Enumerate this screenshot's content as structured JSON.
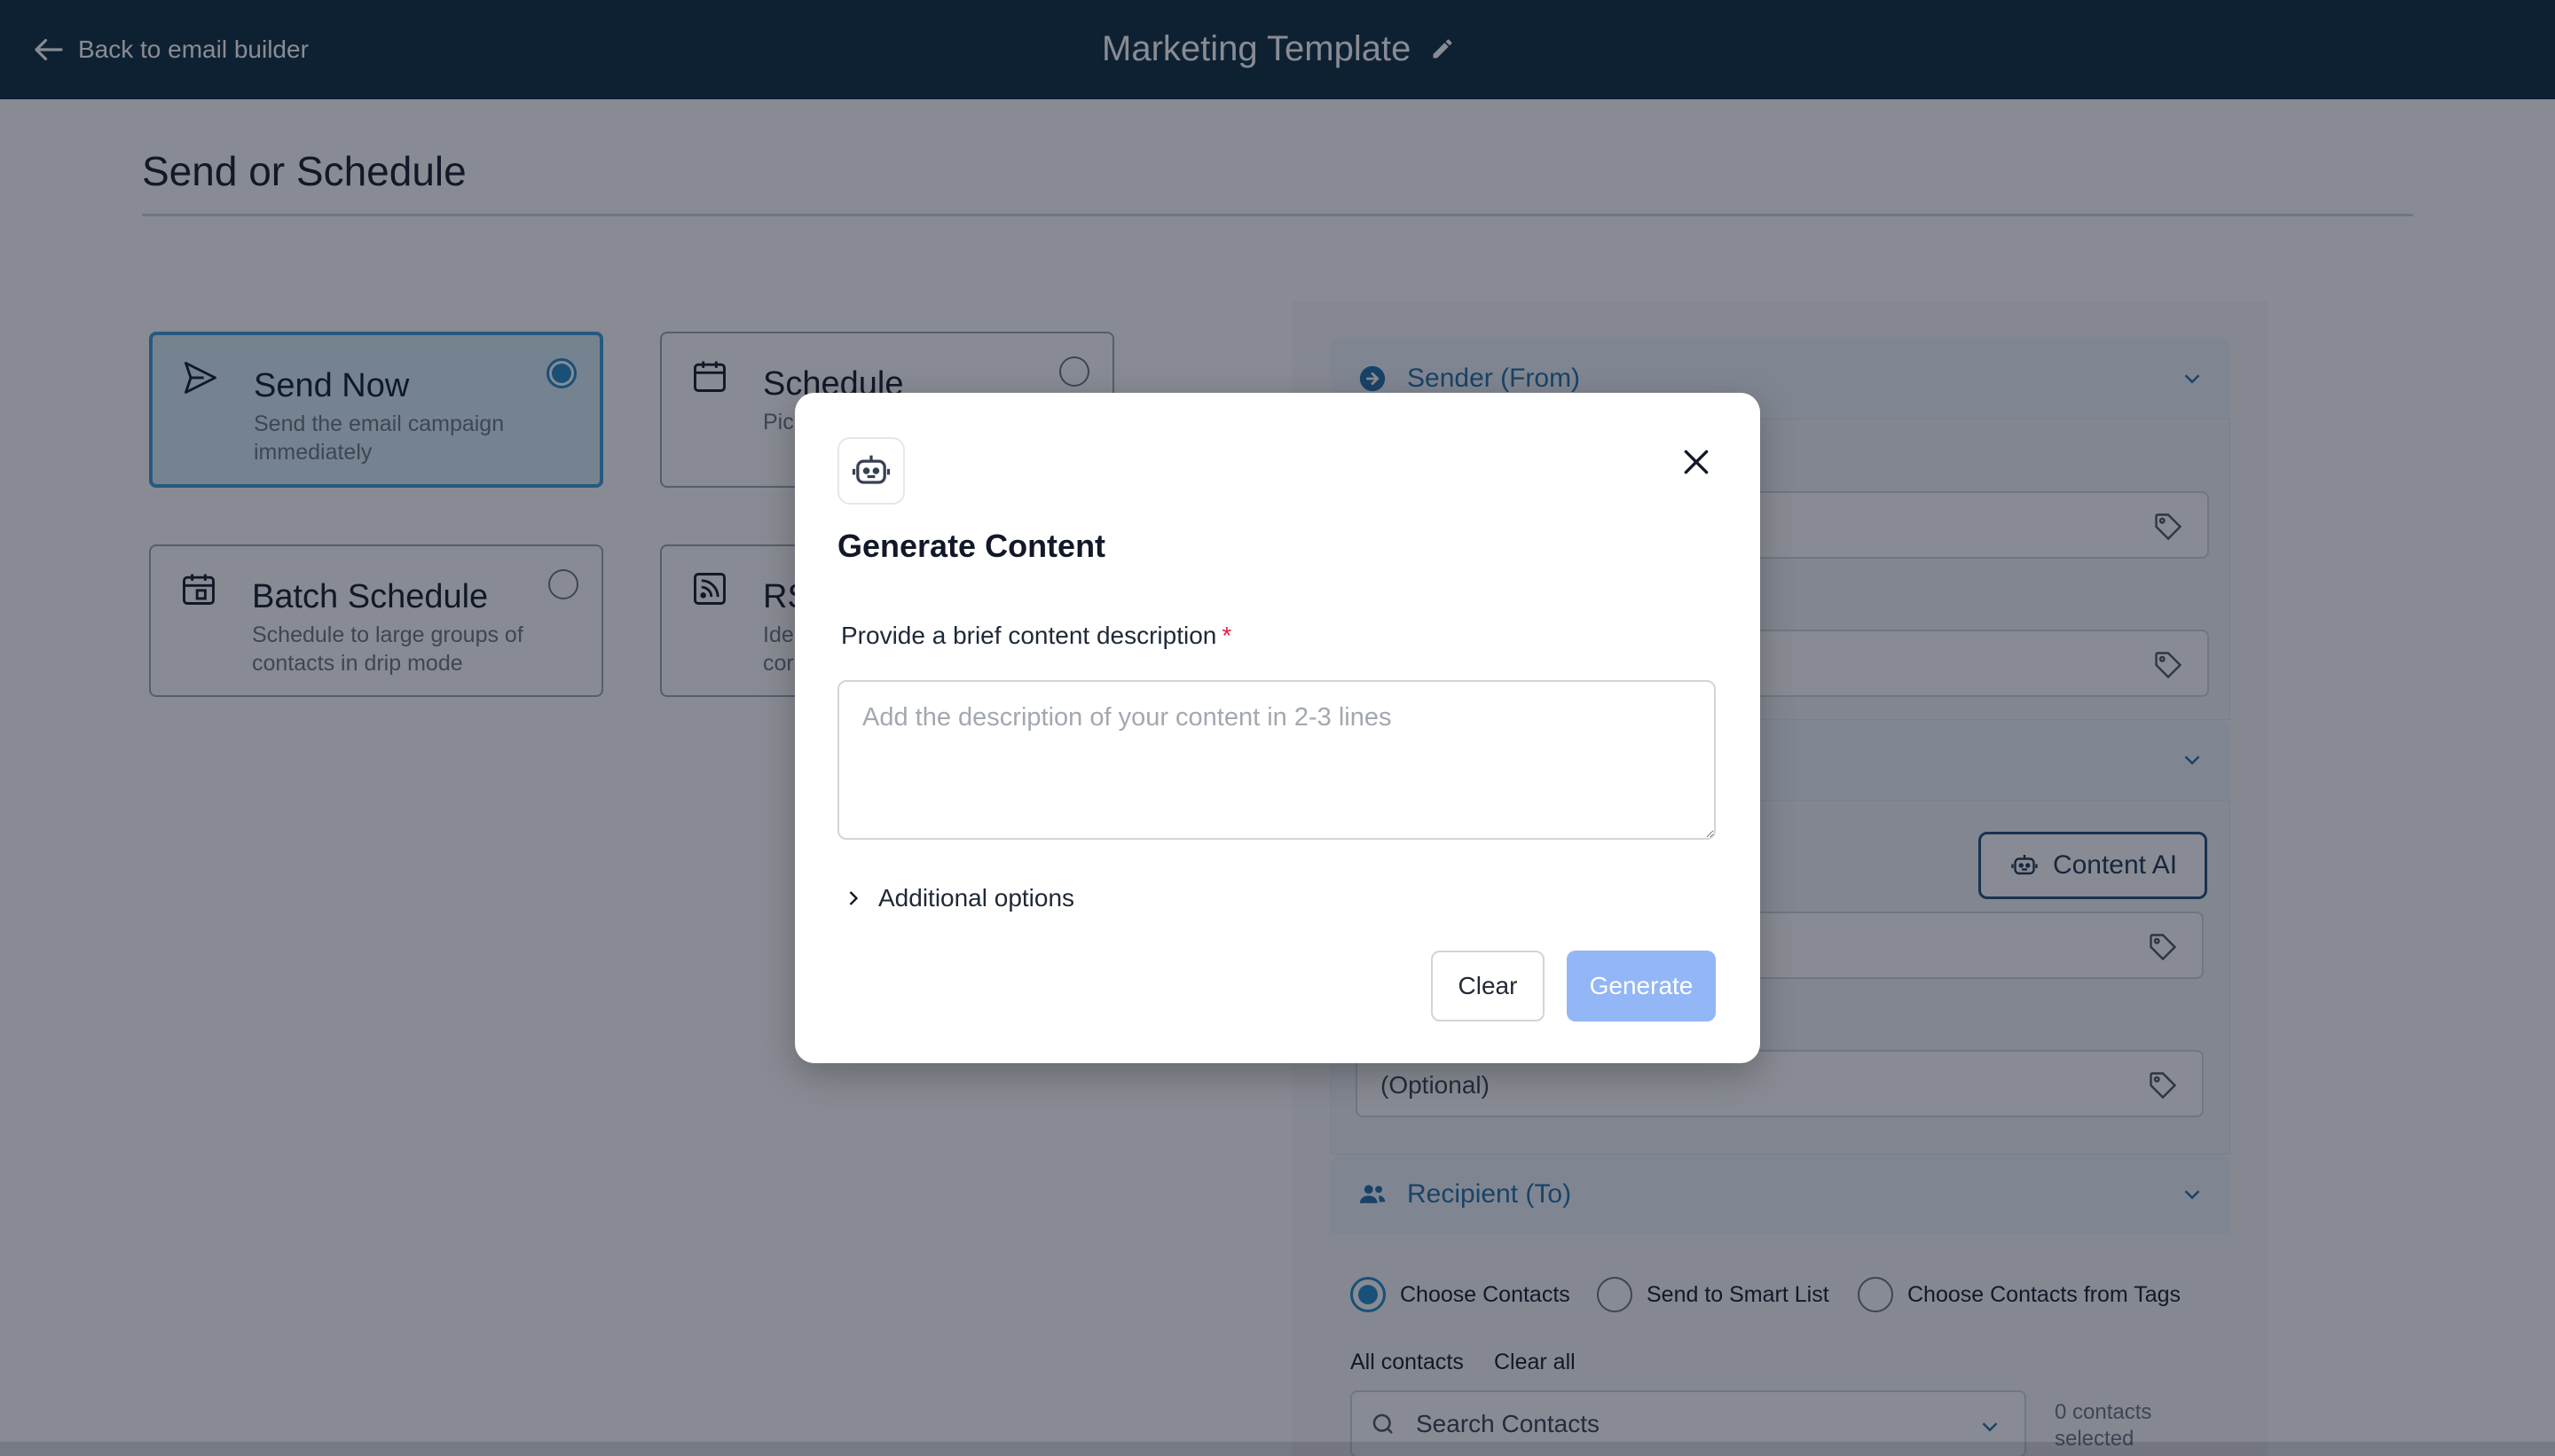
{
  "topbar": {
    "back_label": "Back to email builder",
    "template_title": "Marketing Template"
  },
  "page": {
    "title": "Send or Schedule"
  },
  "send_options": [
    {
      "title": "Send Now",
      "description": "Send the email campaign immediately",
      "selected": true
    },
    {
      "title": "Schedule",
      "description": "Pic",
      "selected": false
    },
    {
      "title": "Batch Schedule",
      "description": "Schedule to large groups of contacts in drip mode",
      "selected": false
    },
    {
      "title": "RS",
      "description": "Ide\ncor",
      "selected": false
    }
  ],
  "panel": {
    "sender_label": "Sender (From)",
    "content_ai_label": "Content AI",
    "optional_placeholder": "(Optional)",
    "recipient_label": "Recipient (To)",
    "recipient_options": [
      "Choose Contacts",
      "Send to Smart List",
      "Choose Contacts from Tags"
    ],
    "all_contacts_label": "All contacts",
    "clear_all_label": "Clear all",
    "search_placeholder": "Search Contacts",
    "contacts_count": "0 contacts selected"
  },
  "modal": {
    "title": "Generate Content",
    "description_label": "Provide a brief content description",
    "required_mark": "*",
    "textarea_placeholder": "Add the description of your content in 2-3 lines",
    "additional_options_label": "Additional options",
    "clear_label": "Clear",
    "generate_label": "Generate"
  },
  "colors": {
    "topbar": "#0b2a3f",
    "accent": "#1e88c8",
    "generate_disabled": "#93b6f7",
    "required": "#e11d48"
  }
}
